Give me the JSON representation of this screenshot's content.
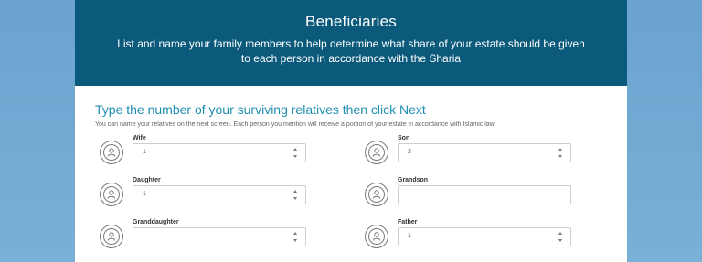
{
  "header": {
    "title": "Beneficiaries",
    "description": "List and name your family members to help determine what share of your estate should be given to each person in accordance with the Sharia"
  },
  "form": {
    "heading": "Type the number of your surviving relatives then click Next",
    "subtitle": "You can name your relatives on the next screen. Each person you mention will receive a portion of your estate in accordance with Islamic law.",
    "fields": [
      {
        "label": "Wife",
        "value": "1"
      },
      {
        "label": "Son",
        "value": "2"
      },
      {
        "label": "Daughter",
        "value": "1"
      },
      {
        "label": "Grandson",
        "value": ""
      },
      {
        "label": "Granddaughter",
        "value": ""
      },
      {
        "label": "Father",
        "value": "1"
      }
    ]
  },
  "icons": {
    "avatar": "user-circle-icon",
    "spinner": "number-stepper-icon"
  },
  "colors": {
    "header_bg": "#0b5a7b",
    "heading": "#1f8fb0",
    "page_bg": "#6fa7d1"
  }
}
